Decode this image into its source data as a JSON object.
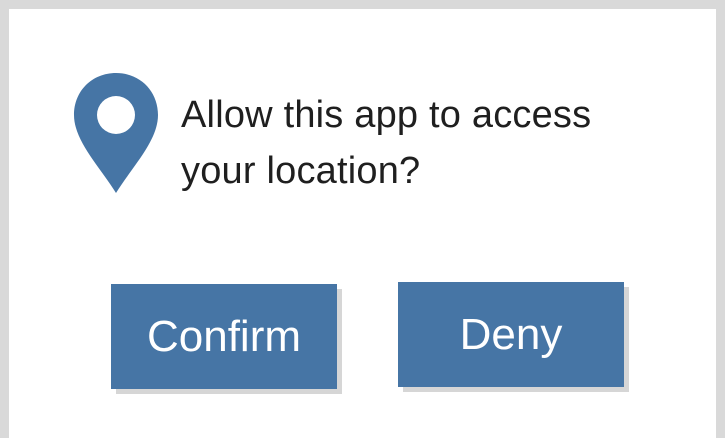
{
  "dialog": {
    "icon": "location-pin-icon",
    "message_line1": "Allow this app to access",
    "message_line2": "your location?",
    "confirm_label": "Confirm",
    "deny_label": "Deny"
  },
  "colors": {
    "accent": "#4675a5",
    "background": "#ffffff",
    "frame": "#d9d9d9",
    "text": "#1f1f1f",
    "button_text": "#ffffff"
  }
}
